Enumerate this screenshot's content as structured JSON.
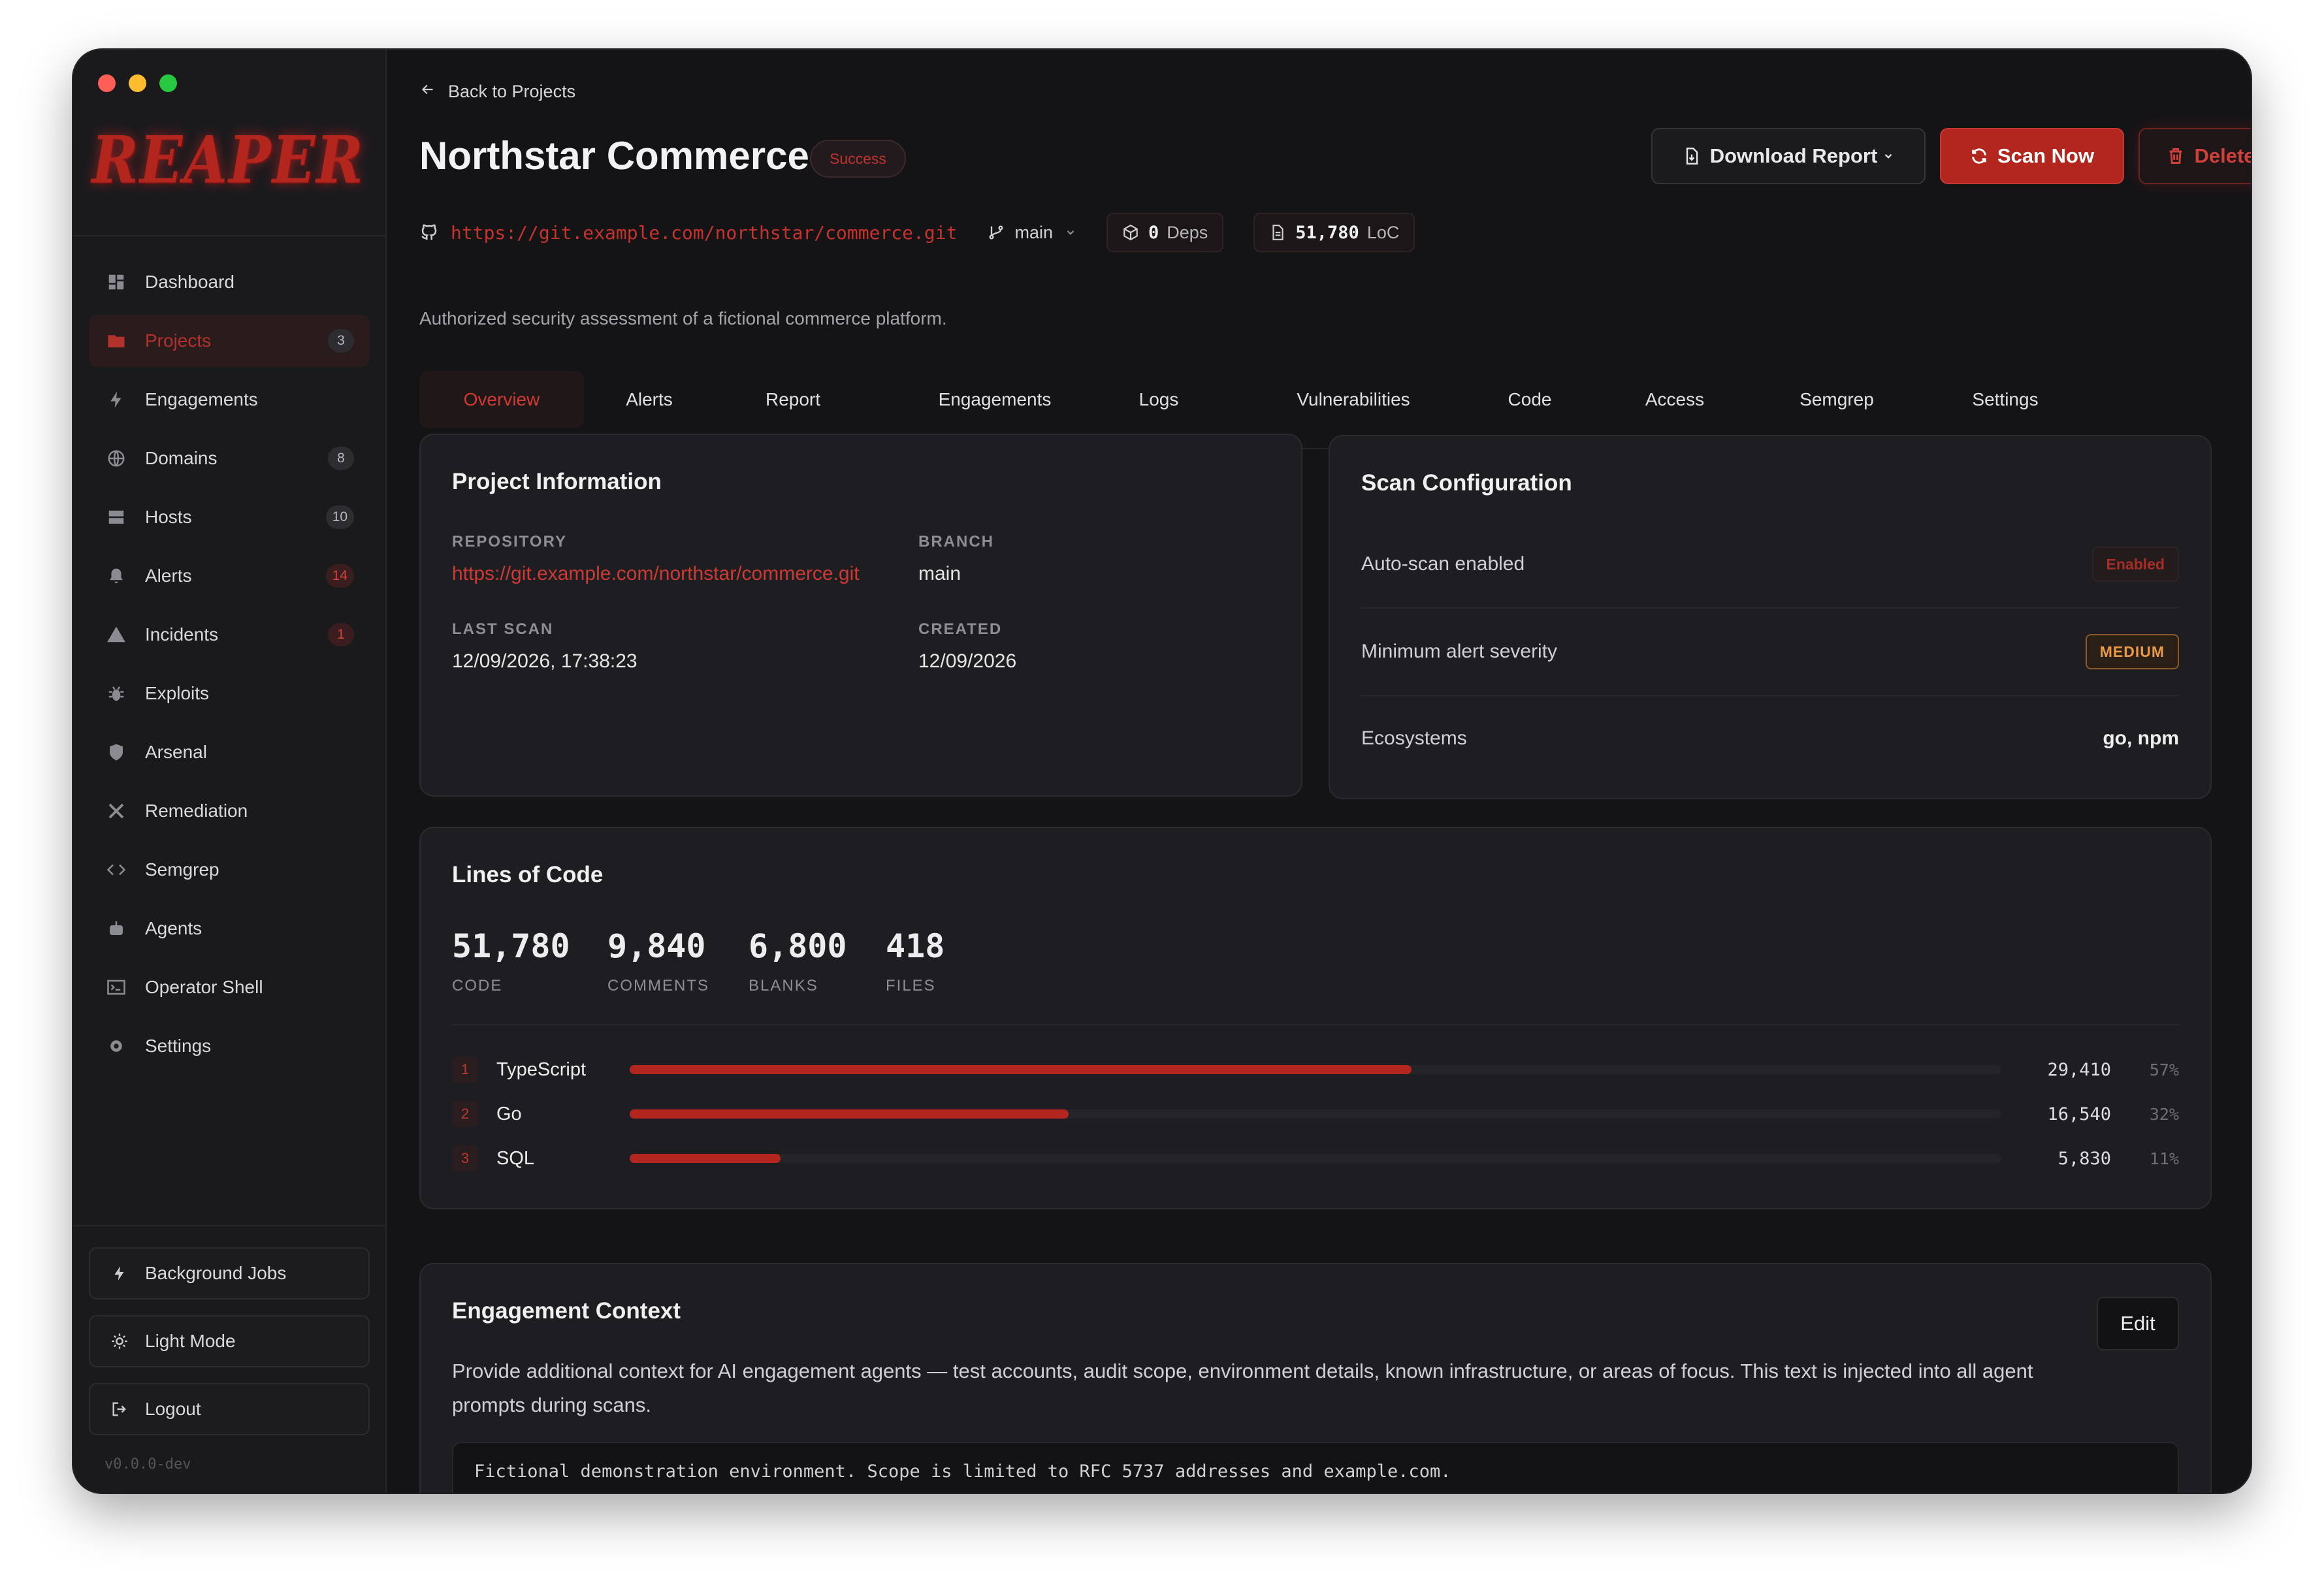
{
  "window": {
    "traffic_lights": [
      "#ff5f57",
      "#febc2e",
      "#28c840"
    ]
  },
  "sidebar": {
    "logo_text": "REAPER",
    "items": [
      {
        "label": "Dashboard",
        "icon": "dashboard-icon",
        "badge": ""
      },
      {
        "label": "Projects",
        "icon": "folder-icon",
        "badge": "3",
        "active": true
      },
      {
        "label": "Engagements",
        "icon": "bolt-icon",
        "badge": ""
      },
      {
        "label": "Domains",
        "icon": "globe-icon",
        "badge": "8"
      },
      {
        "label": "Hosts",
        "icon": "server-icon",
        "badge": "10"
      },
      {
        "label": "Alerts",
        "icon": "bell-icon",
        "badge": "14"
      },
      {
        "label": "Incidents",
        "icon": "warning-icon",
        "badge": "1"
      },
      {
        "label": "Exploits",
        "icon": "bug-icon",
        "badge": ""
      },
      {
        "label": "Arsenal",
        "icon": "shield-icon",
        "badge": ""
      },
      {
        "label": "Remediation",
        "icon": "tools-icon",
        "badge": ""
      },
      {
        "label": "Semgrep",
        "icon": "code-icon",
        "badge": ""
      },
      {
        "label": "Agents",
        "icon": "robot-icon",
        "badge": ""
      },
      {
        "label": "Operator Shell",
        "icon": "terminal-icon",
        "badge": ""
      },
      {
        "label": "Settings",
        "icon": "gear-icon",
        "badge": ""
      }
    ],
    "background_jobs": "Background Jobs",
    "light_mode": "Light Mode",
    "logout": "Logout",
    "version": "v0.0.0-dev"
  },
  "header": {
    "back_label": "Back to Projects",
    "title": "Northstar Commerce",
    "status": "Success",
    "download_label": "Download Report",
    "scan_label": "Scan Now",
    "delete_label": "Delete",
    "repo_url": "https://git.example.com/northstar/commerce.git",
    "branch": "main",
    "deps_count": "0",
    "deps_label": "Deps",
    "loc_count": "51,780",
    "loc_label": "LoC",
    "description": "Authorized security assessment of a fictional commerce platform."
  },
  "tabs": [
    "Overview",
    "Alerts",
    "Report",
    "Engagements",
    "Logs",
    "Vulnerabilities",
    "Code",
    "Access",
    "Semgrep",
    "Settings"
  ],
  "project_info": {
    "title": "Project Information",
    "repository_label": "REPOSITORY",
    "repository": "https://git.example.com/northstar/commerce.git",
    "branch_label": "BRANCH",
    "branch": "main",
    "last_scan_label": "LAST SCAN",
    "last_scan": "12/09/2026, 17:38:23",
    "created_label": "CREATED",
    "created": "12/09/2026"
  },
  "scan_config": {
    "title": "Scan Configuration",
    "auto_scan_label": "Auto-scan enabled",
    "auto_scan_value": "Enabled",
    "min_severity_label": "Minimum alert severity",
    "min_severity_value": "MEDIUM",
    "ecosystems_label": "Ecosystems",
    "ecosystems_value": "go, npm"
  },
  "lines_of_code": {
    "title": "Lines of Code",
    "stats": [
      {
        "value": "51,780",
        "label": "CODE"
      },
      {
        "value": "9,840",
        "label": "COMMENTS"
      },
      {
        "value": "6,800",
        "label": "BLANKS"
      },
      {
        "value": "418",
        "label": "FILES"
      }
    ],
    "languages": [
      {
        "index": "1",
        "name": "TypeScript",
        "count": "29,410",
        "pct": "57%",
        "fraction": 0.57
      },
      {
        "index": "2",
        "name": "Go",
        "count": "16,540",
        "pct": "32%",
        "fraction": 0.32
      },
      {
        "index": "3",
        "name": "SQL",
        "count": "5,830",
        "pct": "11%",
        "fraction": 0.11
      }
    ]
  },
  "engagement_context": {
    "title": "Engagement Context",
    "edit_label": "Edit",
    "description": "Provide additional context for AI engagement agents — test accounts, audit scope, environment details, known infrastructure, or areas of focus. This text is injected into all agent prompts during scans.",
    "content": "Fictional demonstration environment. Scope is limited to RFC 5737 addresses and example.com."
  },
  "colors": {
    "accent": "#b3261e",
    "background": "#141417",
    "card": "#1e1e22"
  }
}
